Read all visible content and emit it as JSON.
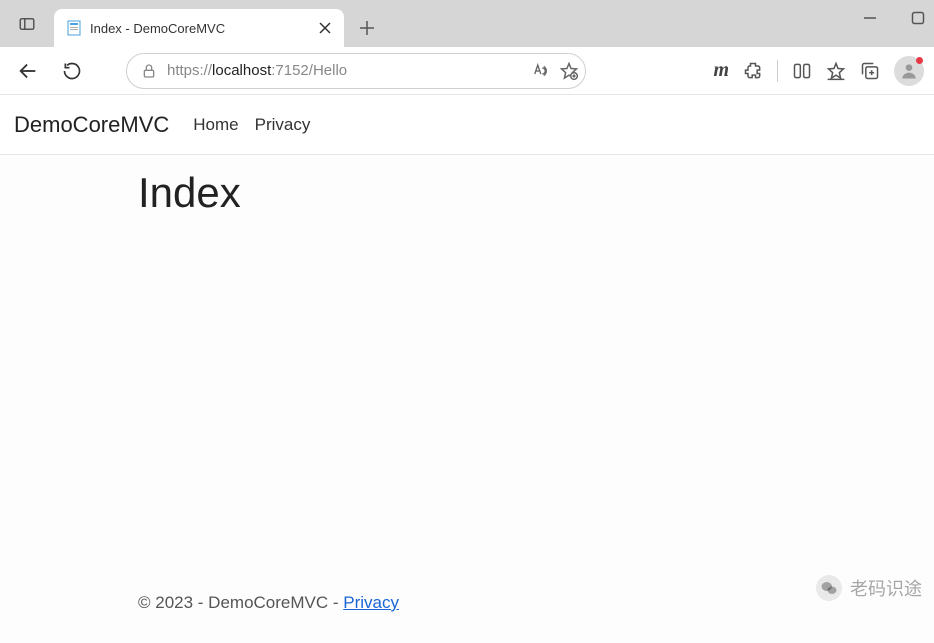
{
  "browser": {
    "tab_title": "Index - DemoCoreMVC",
    "url_protocol": "https://",
    "url_host": "localhost",
    "url_port_path": ":7152/Hello"
  },
  "navbar": {
    "brand": "DemoCoreMVC",
    "links": [
      "Home",
      "Privacy"
    ]
  },
  "content": {
    "heading": "Index"
  },
  "footer": {
    "prefix": "© 2023 - DemoCoreMVC - ",
    "link": "Privacy"
  },
  "watermark": {
    "text": "老码识途"
  }
}
